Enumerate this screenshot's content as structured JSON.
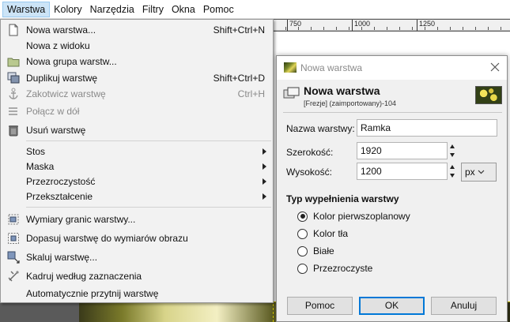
{
  "menubar": {
    "items": [
      "Warstwa",
      "Kolory",
      "Narzędzia",
      "Filtry",
      "Okna",
      "Pomoc"
    ]
  },
  "ruler": {
    "labels": [
      "750",
      "1000",
      "1250"
    ]
  },
  "layer_menu": {
    "items": [
      {
        "label": "Nowa warstwa...",
        "shortcut": "Shift+Ctrl+N",
        "icon": "new-layer-icon"
      },
      {
        "label": "Nowa z widoku",
        "shortcut": "",
        "icon": ""
      },
      {
        "label": "Nowa grupa warstw...",
        "shortcut": "",
        "icon": "folder-icon"
      },
      {
        "label": "Duplikuj warstwę",
        "shortcut": "Shift+Ctrl+D",
        "icon": "duplicate-icon"
      },
      {
        "label": "Zakotwicz warstwę",
        "shortcut": "Ctrl+H",
        "icon": "anchor-icon",
        "disabled": true
      },
      {
        "label": "Połącz w dół",
        "shortcut": "",
        "icon": "merge-down-icon",
        "disabled": true
      },
      {
        "label": "Usuń warstwę",
        "shortcut": "",
        "icon": "trash-icon"
      },
      {
        "label": "Stos",
        "submenu": true
      },
      {
        "label": "Maska",
        "submenu": true
      },
      {
        "label": "Przezroczystość",
        "submenu": true
      },
      {
        "label": "Przekształcenie",
        "submenu": true
      },
      {
        "label": "Wymiary granic warstwy...",
        "icon": "layer-boundary-icon"
      },
      {
        "label": "Dopasuj warstwę do wymiarów obrazu",
        "icon": "layer-to-image-icon"
      },
      {
        "label": "Skaluj warstwę...",
        "icon": "scale-layer-icon"
      },
      {
        "label": "Kadruj według zaznaczenia",
        "icon": "crop-icon"
      },
      {
        "label": "Automatycznie przytnij warstwę",
        "icon": ""
      }
    ]
  },
  "dialog": {
    "window_title": "Nowa warstwa",
    "header_title": "Nowa warstwa",
    "header_subtitle": "[Frezje] (zaimportowany)-104",
    "name_label": "Nazwa warstwy:",
    "name_value": "Ramka",
    "width_label": "Szerokość:",
    "width_value": "1920",
    "height_label": "Wysokość:",
    "height_value": "1200",
    "unit": "px",
    "fill_section": "Typ wypełnienia warstwy",
    "fill_options": [
      "Kolor pierwszoplanowy",
      "Kolor tła",
      "Białe",
      "Przezroczyste"
    ],
    "fill_selected": "Kolor pierwszoplanowy",
    "buttons": {
      "help": "Pomoc",
      "ok": "OK",
      "cancel": "Anuluj"
    }
  },
  "colors": {
    "menu_active": "#cce4f7",
    "primary_border": "#0078d7"
  }
}
